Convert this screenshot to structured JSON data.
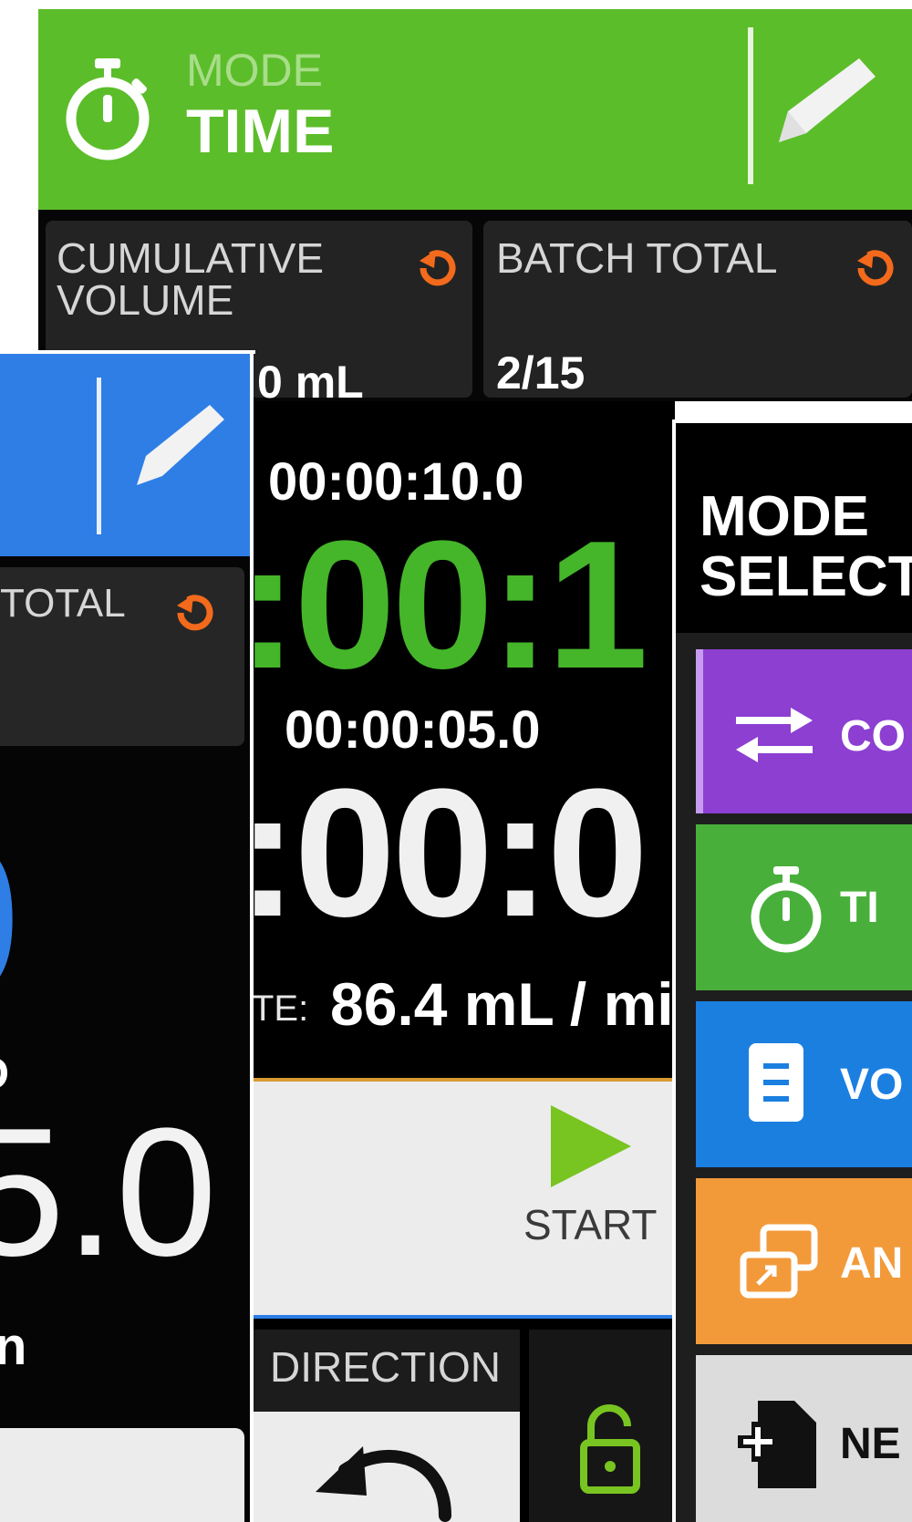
{
  "colors": {
    "time_green": "#5cbd2a",
    "timer_green": "#45b52a",
    "volume_blue": "#2e7ee6",
    "continuous_purple": "#8c3fd1",
    "antibiotic_orange": "#f29a3a",
    "reset_orange": "#f36a1c",
    "start_green": "#78c421"
  },
  "time_screen": {
    "mode_label": "MODE",
    "mode_value": "TIME",
    "icons": [
      "stopwatch-icon",
      "pencil-icon",
      "reset-icon"
    ],
    "cumulative_volume_label_line1": "CUMULATIVE",
    "cumulative_volume_label_line2": "VOLUME",
    "cumulative_volume_value": "0 mL",
    "batch_total_label": "BATCH TOTAL",
    "batch_total_value": "2/15"
  },
  "volume_screen": {
    "batch_total_partial": "TOTAL",
    "big_value_partial": "0",
    "label_partial": "D",
    "value_partial": "5.0",
    "unit_partial": "n",
    "icons": [
      "pencil-icon",
      "reset-icon"
    ]
  },
  "timer_panel": {
    "set_time_1": "00:00:10.0",
    "countdown_1": ":00:1",
    "set_time_2": "00:00:05.0",
    "countdown_2": ":00:0",
    "rate_label_partial": "TE:",
    "rate_value": "86.4 mL / mi",
    "start_label": "START",
    "direction_label": "DIRECTION",
    "icons": [
      "play-icon",
      "rotate-left-icon",
      "unlock-icon"
    ]
  },
  "mode_select": {
    "title_line1": "MODE",
    "title_line2": "SELECT",
    "items": [
      {
        "label": "CO",
        "icon": "swap-arrows-icon",
        "color": "#8c3fd1"
      },
      {
        "label": "TI",
        "icon": "stopwatch-icon",
        "color": "#48b03a"
      },
      {
        "label": "VO",
        "icon": "document-icon",
        "color": "#1b7fe0"
      },
      {
        "label": "AN",
        "icon": "open-window-icon",
        "color": "#f29a3a"
      },
      {
        "label": "NE",
        "icon": "new-file-icon",
        "color": "#dcdcdc"
      }
    ]
  }
}
